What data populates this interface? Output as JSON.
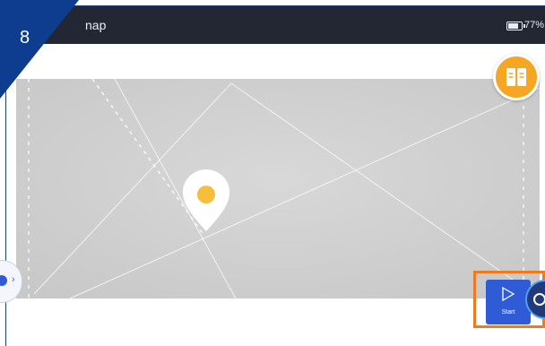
{
  "step_badge": {
    "number": "8",
    "color": "#0e3c8f"
  },
  "statusbar": {
    "title": "nap",
    "battery_level": 0.77,
    "battery_text": "77%"
  },
  "map": {
    "pin_color": "#f4c03a",
    "background": "#cfcfcf"
  },
  "buttons": {
    "guide_icon": "book-icon",
    "start_label": "Start",
    "start_icon": "play-icon",
    "locate_icon": "location-icon",
    "side_icon": "chevron-right-icon"
  },
  "colors": {
    "accent": "#2f5bd6",
    "highlight": "#f07a1f",
    "guide": "#f5a623"
  }
}
